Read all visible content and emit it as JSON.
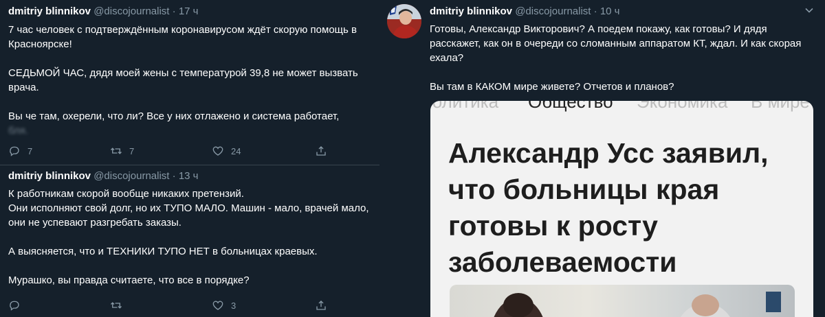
{
  "tweets_left": [
    {
      "name": "dmitriy blinnikov",
      "handle": "@discojournalist",
      "dot": "·",
      "time": "17 ч",
      "paragraphs": [
        "7 час человек с подтверждённым коронавирусом ждёт скорую помощь в Красноярске!",
        "СЕДЬМОЙ ЧАС, дядя моей жены с температурой 39,8 не может вызвать врача.",
        "Вы че там, охерели, что ли? Все у них отлажено и система работает,"
      ],
      "blurred_text": "бля.",
      "replies": "7",
      "retweets": "7",
      "likes": "24"
    },
    {
      "name": "dmitriy blinnikov",
      "handle": "@discojournalist",
      "dot": "·",
      "time": "13 ч",
      "paragraphs": [
        "К работникам скорой вообще никаких претензий.",
        "Они исполняют свой долг, но их ТУПО МАЛО. Машин - мало, врачей мало, они не успевают разгребать заказы.",
        "А выясняется, что и ТЕХНИКИ ТУПО НЕТ в больницах краевых.",
        "Мурашко, вы правда считаете, что все в порядке?"
      ],
      "replies": "",
      "retweets": "",
      "likes": "3"
    }
  ],
  "tweet_right": {
    "name": "dmitriy blinnikov",
    "handle": "@discojournalist",
    "dot": "·",
    "time": "10 ч",
    "paragraphs": [
      "Готовы, Александр Викторович? А поедем покажу, как готовы? И дядя расскажет, как он в очереди со сломанным аппаратом КТ, ждал. И как скорая ехала?",
      "Вы там в КАКОМ мире живете? Отчетов и планов?"
    ],
    "card": {
      "tabs": [
        "Политика",
        "Общество",
        "Экономика",
        "В мире"
      ],
      "headline_lines": [
        "Александр Усс заявил,",
        "что больницы края",
        "готовы к росту",
        "заболеваемости"
      ]
    }
  },
  "colors": {
    "background": "#15202b",
    "text": "#ffffff",
    "secondary": "#8899a6",
    "separator": "#38444d"
  },
  "icons": [
    "reply-icon",
    "retweet-icon",
    "like-icon",
    "share-icon",
    "chevron-down-icon"
  ]
}
